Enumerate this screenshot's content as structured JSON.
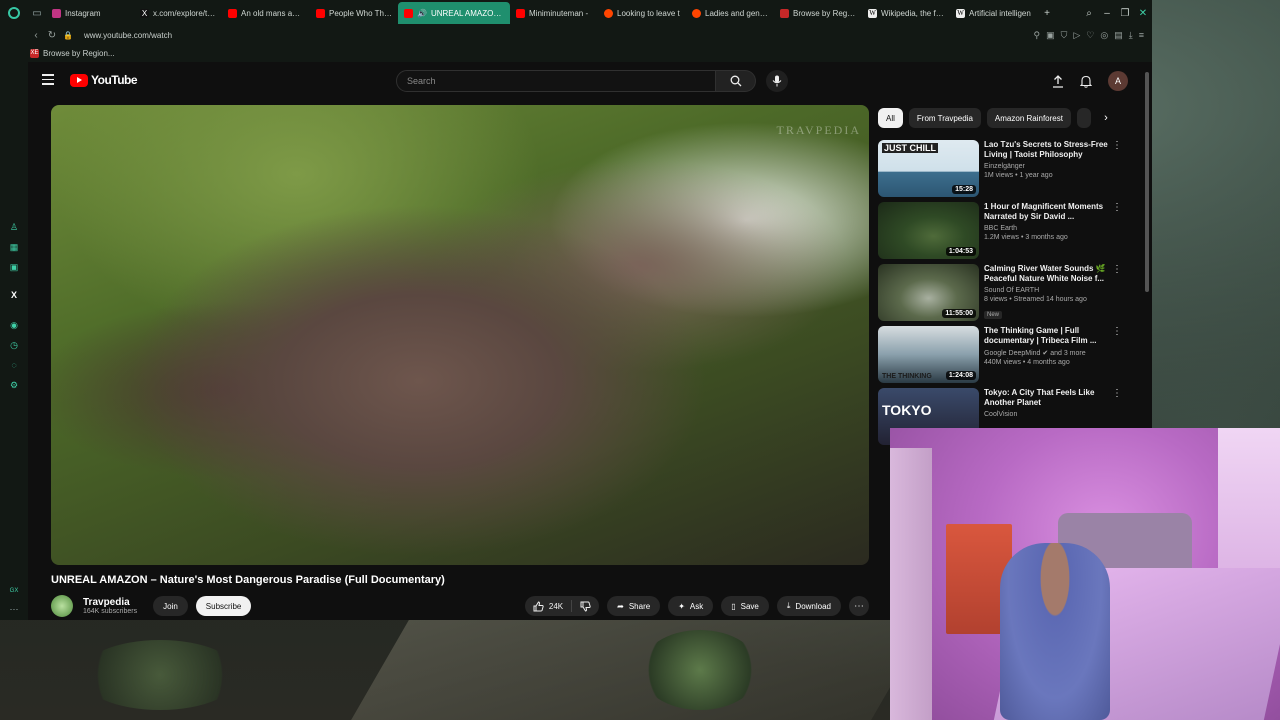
{
  "browser": {
    "tabs": [
      {
        "title": "Instagram",
        "color": "#c13584"
      },
      {
        "title": "x.com/explore/tab",
        "color": "#dddddd"
      },
      {
        "title": "An old mans advic",
        "color": "#ff0000"
      },
      {
        "title": "People Who Think",
        "color": "#ff0000"
      },
      {
        "title": "UNREAL AMAZON – N",
        "color": "#ff0000",
        "active": true
      },
      {
        "title": "Miniminuteman -",
        "color": "#ff0000"
      },
      {
        "title": "Looking to leave t",
        "color": "#ff4500"
      },
      {
        "title": "Ladies and gentle",
        "color": "#ff4500"
      },
      {
        "title": "Browse by Region",
        "color": "#c62828"
      },
      {
        "title": "Wikipedia, the free",
        "color": "#dddddd"
      },
      {
        "title": "Artificial intelligen",
        "color": "#dddddd"
      }
    ],
    "url": "www.youtube.com/watch",
    "bookmark_label": "Browse by Region...",
    "bookmark_icon_text": "XE",
    "sidebar_bottom_label": "GX"
  },
  "youtube": {
    "logo_text": "YouTube",
    "search_placeholder": "Search",
    "avatar_letter": "A",
    "watermark": "TRAVPEDIA",
    "video_title": "UNREAL AMAZON – Nature's Most Dangerous Paradise (Full Documentary)",
    "channel": {
      "name": "Travpedia",
      "subscribers": "164K subscribers"
    },
    "buttons": {
      "join": "Join",
      "subscribe": "Subscribe",
      "likes": "24K",
      "share": "Share",
      "ask": "Ask",
      "save": "Save",
      "download": "Download"
    },
    "chips": [
      "All",
      "From Travpedia",
      "Amazon Rainforest"
    ],
    "recommendations": [
      {
        "title": "Lao Tzu's Secrets to Stress-Free Living | Taoist Philosophy",
        "channel": "Einzelgänger",
        "meta": "1M views • 1 year ago",
        "duration": "15:28",
        "thumb_text": "JUST CHILL",
        "badge": ""
      },
      {
        "title": "1 Hour of Magnificent Moments Narrated by Sir David ...",
        "channel": "BBC Earth",
        "meta": "1.2M views • 3 months ago",
        "duration": "1:04:53",
        "thumb_text": "",
        "badge": ""
      },
      {
        "title": "Calming River Water Sounds 🌿 Peaceful Nature White Noise f...",
        "channel": "Sound Of EARTH",
        "meta": "8 views • Streamed 14 hours ago",
        "duration": "11:55:00",
        "thumb_text": "",
        "badge": "New"
      },
      {
        "title": "The Thinking Game | Full documentary | Tribeca Film ...",
        "channel": "Google DeepMind",
        "meta": "440M views • 4 months ago",
        "duration": "1:24:08",
        "thumb_text": "THE THINKING",
        "badge": "",
        "channel_extra": "and 3 more"
      },
      {
        "title": "Tokyo: A City That Feels Like Another Planet",
        "channel": "CoolVision",
        "meta": "",
        "duration": "",
        "thumb_text": "TOKYO",
        "badge": ""
      }
    ]
  },
  "colors": {
    "accent": "#1f8f6e",
    "yt_red": "#ff0000",
    "bg": "#0f0f0f"
  }
}
